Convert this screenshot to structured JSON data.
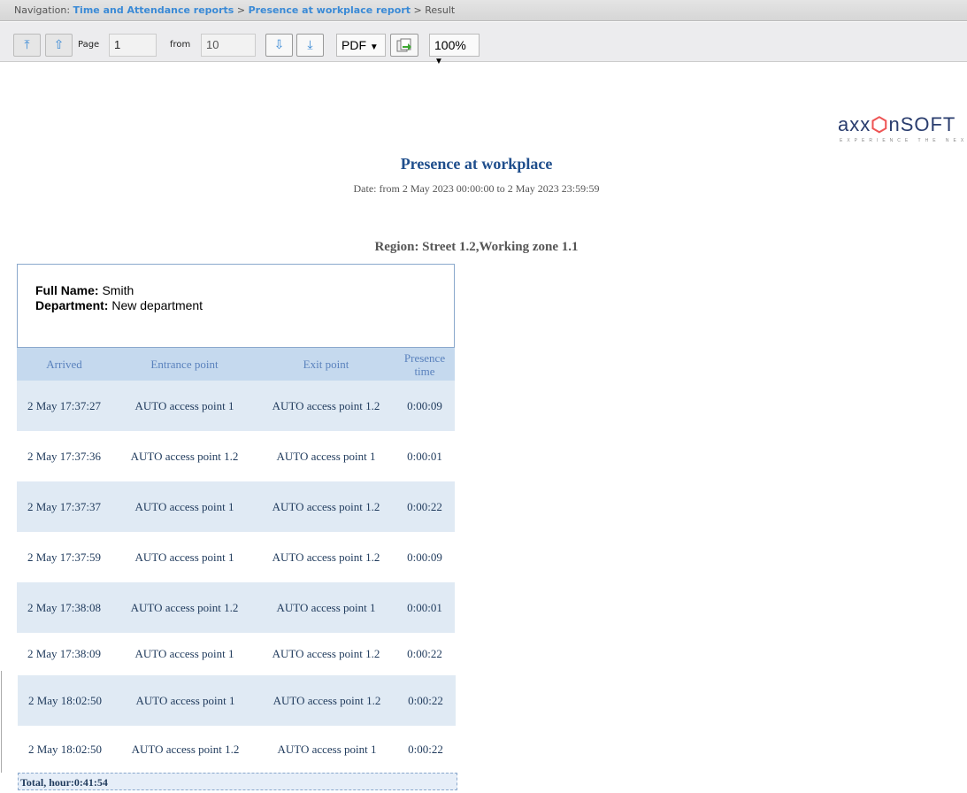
{
  "navigation": {
    "label": "Navigation:",
    "crumbs": [
      "Time and Attendance reports",
      "Presence at workplace report"
    ],
    "current": "Result",
    "sep": ">"
  },
  "toolbar": {
    "first_icon": "⤒",
    "prev_icon": "⇧",
    "page_label": "Page",
    "page_value": "1",
    "from_label": "from",
    "from_value": "10",
    "next_icon": "⇩",
    "last_icon": "⤓",
    "format": "PDF",
    "export_icon": "export-icon",
    "zoom": "100%"
  },
  "logo": {
    "text": "axxonsoft",
    "tagline": "EXPERIENCE THE NEXT"
  },
  "report": {
    "title": "Presence at workplace",
    "date_range": "Date: from 2 May 2023 00:00:00 to 2 May 2023 23:59:59",
    "region": "Region: Street 1.2,Working zone 1.1",
    "full_name_label": "Full Name:",
    "full_name": "Smith",
    "department_label": "Department:",
    "department": "New department",
    "columns": [
      "Arrived",
      "Entrance point",
      "Exit point",
      "Presence time"
    ],
    "rows": [
      [
        "2 May 17:37:27",
        "AUTO access point 1",
        "AUTO access point 1.2",
        "0:00:09"
      ],
      [
        "2 May 17:37:36",
        "AUTO access point 1.2",
        "AUTO access point 1",
        "0:00:01"
      ],
      [
        "2 May 17:37:37",
        "AUTO access point 1",
        "AUTO access point 1.2",
        "0:00:22"
      ],
      [
        "2 May 17:37:59",
        "AUTO access point 1",
        "AUTO access point 1.2",
        "0:00:09"
      ],
      [
        "2 May 17:38:08",
        "AUTO access point 1.2",
        "AUTO access point 1",
        "0:00:01"
      ],
      [
        "2 May 17:38:09",
        "AUTO access point 1",
        "AUTO access point 1.2",
        "0:00:22"
      ],
      [
        "2 May 18:02:50",
        "AUTO access point 1",
        "AUTO access point 1.2",
        "0:00:22"
      ],
      [
        "2 May 18:02:50",
        "AUTO access point 1.2",
        "AUTO access point 1",
        "0:00:22"
      ]
    ],
    "total": "Total, hour:0:41:54"
  }
}
